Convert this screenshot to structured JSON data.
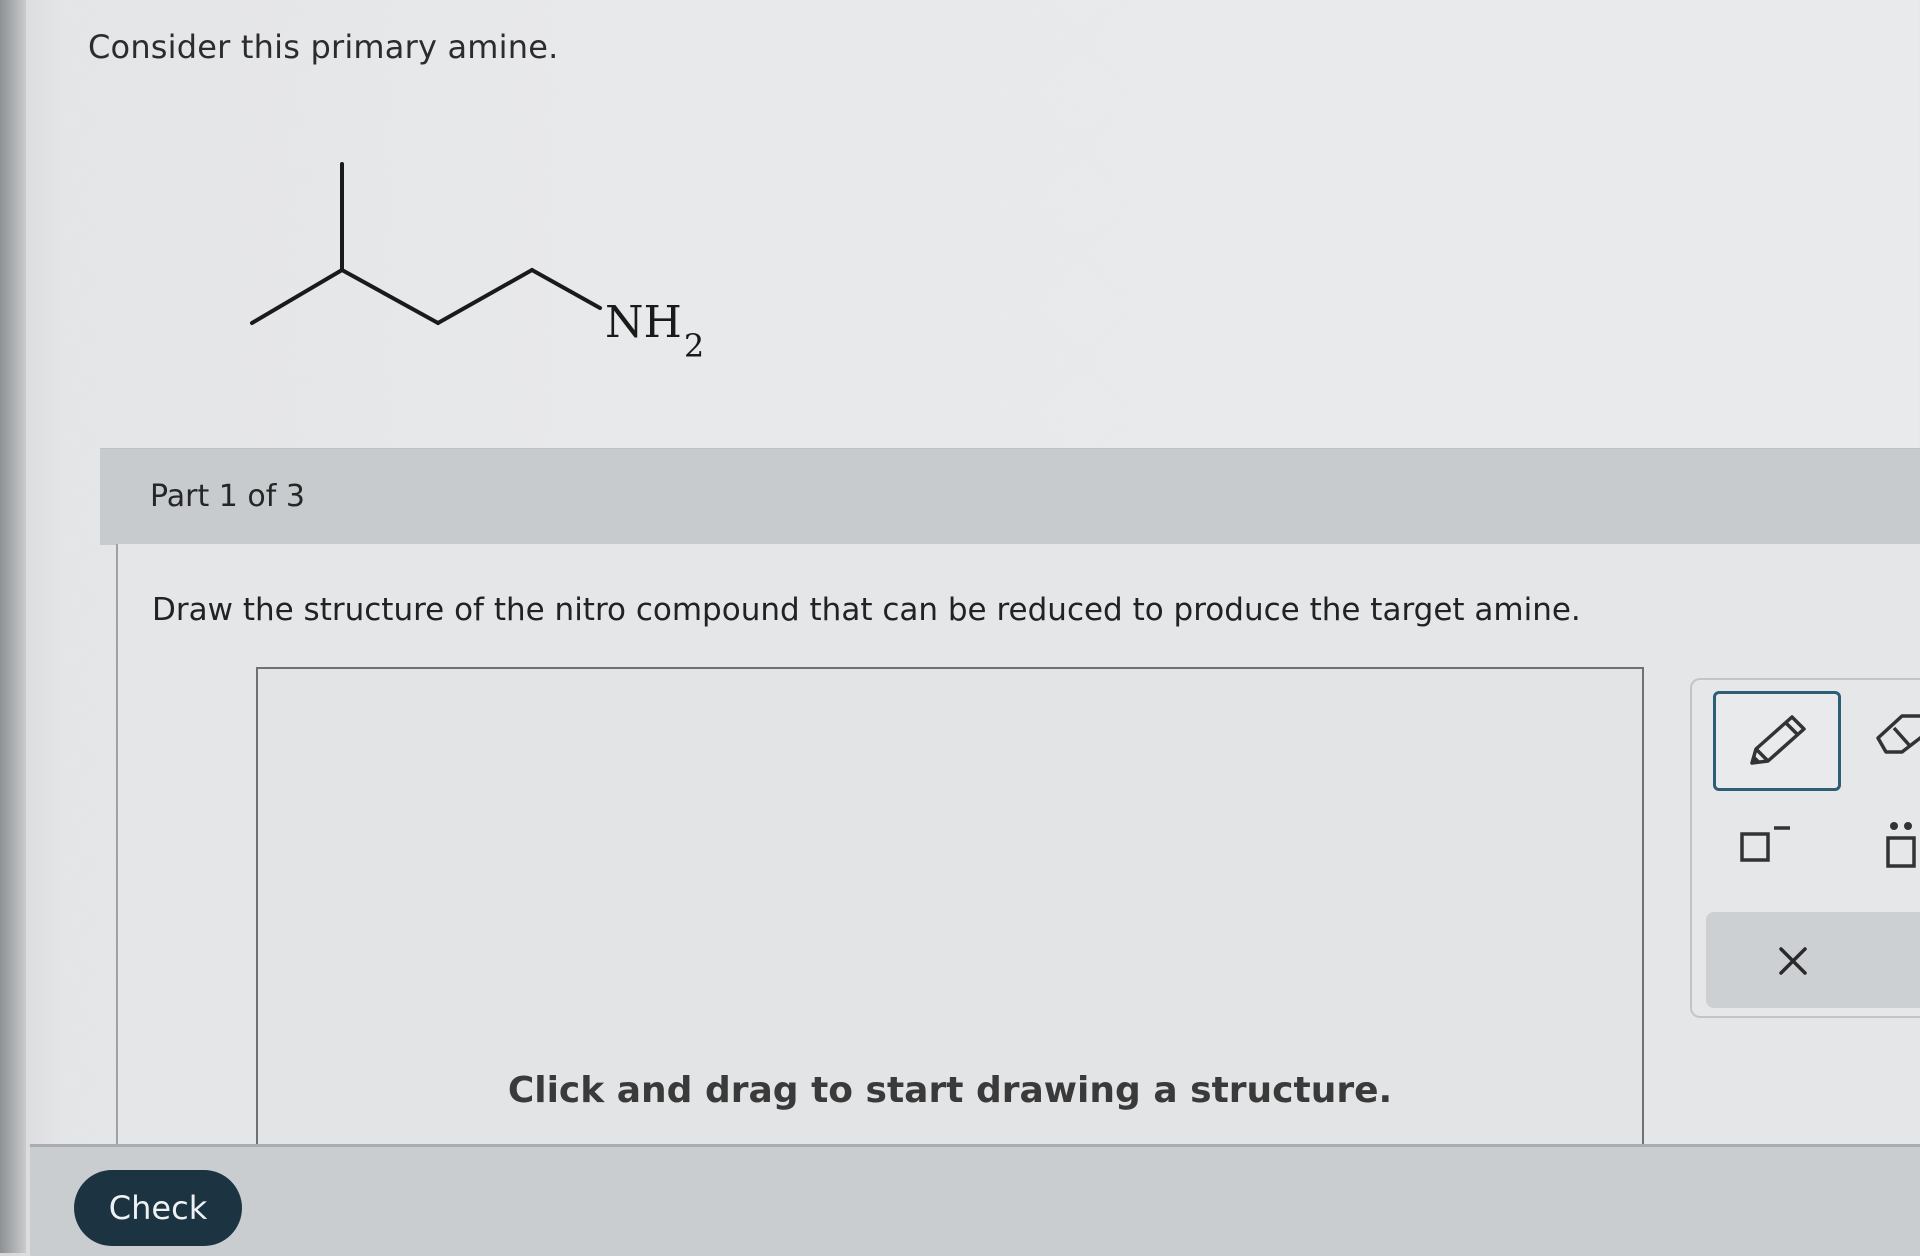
{
  "question": {
    "prompt": "Consider this primary amine.",
    "molecule": {
      "label_main": "NH",
      "label_sub": "2"
    }
  },
  "part": {
    "label": "Part 1 of 3",
    "instruction": "Draw the structure of the nitro compound that can be reduced to produce the target amine."
  },
  "canvas": {
    "hint": "Click and drag to start drawing a structure."
  },
  "toolbar": {
    "tools": [
      "pencil-icon",
      "eraser-icon",
      "charge-icon",
      "lone-pair-icon",
      "close-icon"
    ],
    "active_tool": "pencil-icon",
    "accent_color": "#2d5e77"
  },
  "footer": {
    "check_label": "Check",
    "check_color": "#1c3441"
  }
}
